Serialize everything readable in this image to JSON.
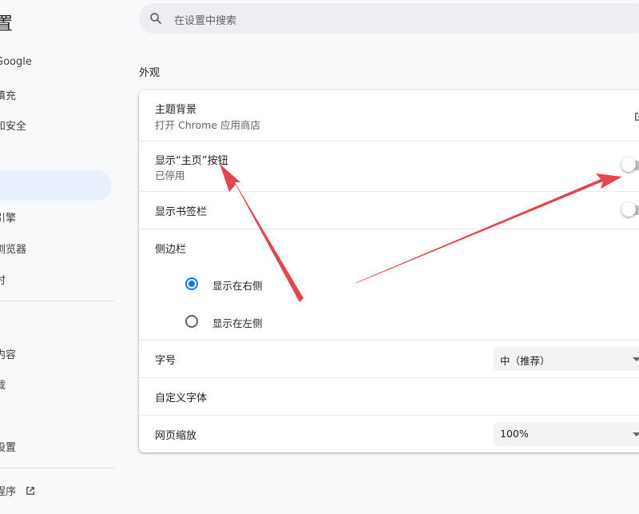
{
  "sidebar": {
    "title": "置",
    "items": {
      "google": "Google",
      "autofill": "填充",
      "privacy": "和安全",
      "search_engine": "引擎",
      "default_browser": "浏览器",
      "startup": "时",
      "languages": "内容",
      "downloads": "载",
      "reset": "设置",
      "extensions": "程序"
    }
  },
  "search": {
    "placeholder": "在设置中搜索"
  },
  "appearance": {
    "section_title": "外观",
    "theme": {
      "label": "主题背景",
      "sub": "打开 Chrome 应用商店"
    },
    "home_button": {
      "label": "显示“主页”按钮",
      "sub": "已停用",
      "enabled": false
    },
    "bookmarks_bar": {
      "label": "显示书签栏",
      "enabled": false
    },
    "side_panel": {
      "label": "侧边栏",
      "options": [
        "显示在右侧",
        "显示在左侧"
      ],
      "selected": "显示在右侧"
    },
    "font_size": {
      "label": "字号",
      "value": "中（推荐）"
    },
    "custom_fonts": {
      "label": "自定义字体"
    },
    "page_zoom": {
      "label": "网页缩放",
      "value": "100%"
    }
  },
  "colors": {
    "accent": "#1a73e8",
    "active_nav": "#e8f0fe",
    "annotation_arrow": "#e0474c"
  }
}
